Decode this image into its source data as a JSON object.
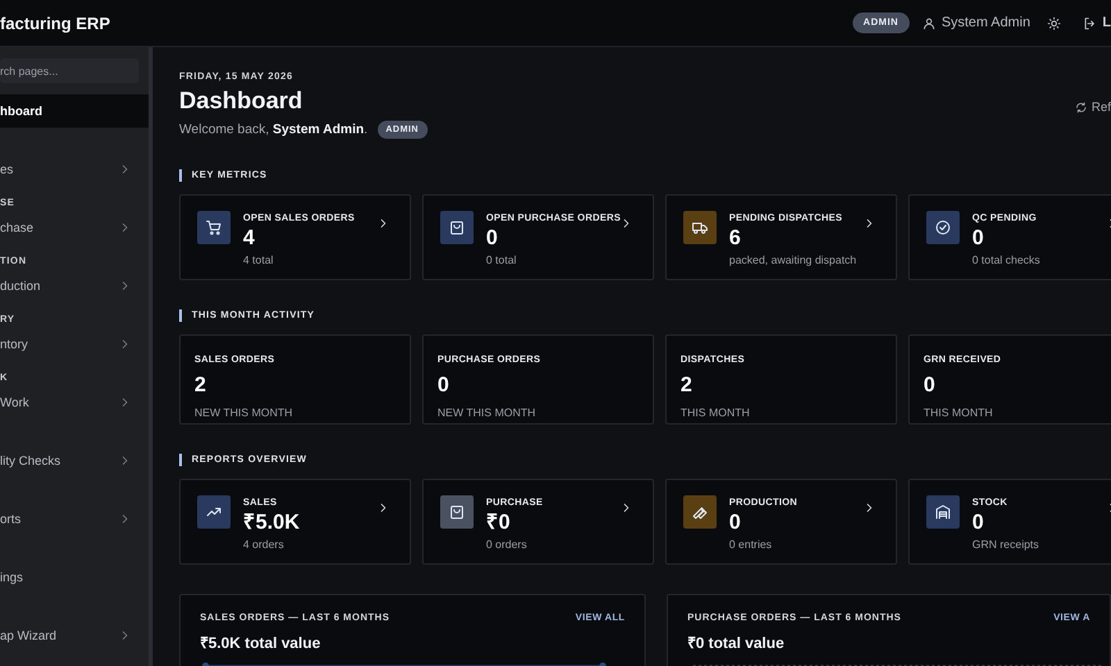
{
  "header": {
    "brand": "facturing ERP",
    "role_badge": "ADMIN",
    "user": "System Admin",
    "logout": "L"
  },
  "sidebar": {
    "search": {
      "placeholder": "rch pages..."
    },
    "groups": [
      {
        "items": [
          {
            "label": "hboard",
            "selected": true,
            "has_submenu": false
          }
        ]
      },
      {
        "items": [
          {
            "label": "es",
            "selected": false,
            "has_submenu": true
          }
        ]
      },
      {
        "label": "SE",
        "items": [
          {
            "label": "chase",
            "selected": false,
            "has_submenu": true
          }
        ]
      },
      {
        "label": "TION",
        "items": [
          {
            "label": "duction",
            "selected": false,
            "has_submenu": true
          }
        ]
      },
      {
        "label": "RY",
        "items": [
          {
            "label": "ntory",
            "selected": false,
            "has_submenu": true
          }
        ]
      },
      {
        "label": "K",
        "items": [
          {
            "label": "Work",
            "selected": false,
            "has_submenu": true
          }
        ]
      },
      {
        "items": [
          {
            "label": "lity Checks",
            "selected": false,
            "has_submenu": true
          }
        ]
      },
      {
        "items": [
          {
            "label": "orts",
            "selected": false,
            "has_submenu": true
          }
        ]
      },
      {
        "items": [
          {
            "label": "ings",
            "selected": false,
            "has_submenu": false
          }
        ]
      },
      {
        "items": [
          {
            "label": "ap Wizard",
            "selected": false,
            "has_submenu": true
          }
        ]
      }
    ]
  },
  "page": {
    "date": "FRIDAY, 15 MAY 2026",
    "title": "Dashboard",
    "welcome": "Welcome back, **System Admin**.",
    "role_badge": "ADMIN",
    "refresh": "Ref"
  },
  "key_metrics": {
    "title": "KEY METRICS",
    "cards": [
      {
        "label": "OPEN SALES ORDERS",
        "value": "4",
        "sub": "4 total",
        "color": "#2a3a5e"
      },
      {
        "label": "OPEN PURCHASE ORDERS",
        "value": "0",
        "sub": "0 total",
        "color": "#2a3a5e"
      },
      {
        "label": "PENDING DISPATCHES",
        "value": "6",
        "sub": "packed, awaiting dispatch",
        "color": "#5a3f12"
      },
      {
        "label": "QC PENDING",
        "value": "0",
        "sub": "0 total checks",
        "color": "#2a3a5e"
      }
    ]
  },
  "month_activity": {
    "title": "THIS MONTH ACTIVITY",
    "cards": [
      {
        "label": "SALES ORDERS",
        "value": "2",
        "sub": "NEW THIS MONTH"
      },
      {
        "label": "PURCHASE ORDERS",
        "value": "0",
        "sub": "NEW THIS MONTH"
      },
      {
        "label": "DISPATCHES",
        "value": "2",
        "sub": "THIS MONTH"
      },
      {
        "label": "GRN RECEIVED",
        "value": "0",
        "sub": "THIS MONTH"
      }
    ]
  },
  "reports_overview": {
    "title": "REPORTS OVERVIEW",
    "cards": [
      {
        "label": "SALES",
        "value": "₹5.0K",
        "sub": "4 orders",
        "color": "#2a3a5e"
      },
      {
        "label": "PURCHASE",
        "value": "₹0",
        "sub": "0 orders",
        "color": "#4a5262"
      },
      {
        "label": "PRODUCTION",
        "value": "0",
        "sub": "0 entries",
        "color": "#5a3f12"
      },
      {
        "label": "STOCK",
        "value": "0",
        "sub": "GRN receipts",
        "color": "#2a3a5e"
      }
    ]
  },
  "charts": [
    {
      "title": "SALES ORDERS — LAST 6 MONTHS",
      "link": "VIEW ALL",
      "total": "₹5.0K total value"
    },
    {
      "title": "PURCHASE ORDERS — LAST 6 MONTHS",
      "link": "VIEW A",
      "total": "₹0 total value"
    }
  ]
}
